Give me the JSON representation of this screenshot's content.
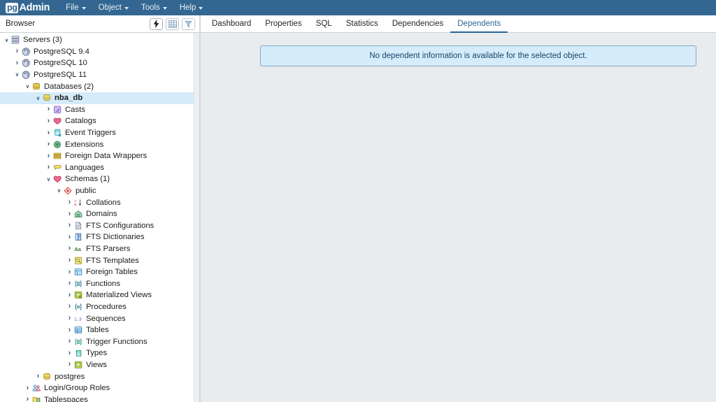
{
  "app": {
    "brand_pg": "pg",
    "brand_admin": "Admin",
    "accent_color": "#336791",
    "selection_color": "#d4ebfa",
    "link_color": "#2a6496"
  },
  "menubar": {
    "items": [
      {
        "label": "File",
        "icon": "chevron-down-icon"
      },
      {
        "label": "Object",
        "icon": "chevron-down-icon"
      },
      {
        "label": "Tools",
        "icon": "chevron-down-icon"
      },
      {
        "label": "Help",
        "icon": "chevron-down-icon"
      }
    ]
  },
  "browser": {
    "title": "Browser",
    "toolbar": [
      {
        "name": "quick-query-tool-button",
        "icon": "lightning-bolt-icon",
        "state": "enabled"
      },
      {
        "name": "view-data-button",
        "icon": "grid-table-icon",
        "state": "muted"
      },
      {
        "name": "filter-button",
        "icon": "funnel-filter-icon",
        "state": "muted"
      }
    ],
    "tree": [
      {
        "label": "Servers (3)",
        "depth": 0,
        "twisty": "expanded",
        "icon": "servers-icon"
      },
      {
        "label": "PostgreSQL 9.4",
        "depth": 1,
        "twisty": "collapsed",
        "icon": "postgres-elephant-icon"
      },
      {
        "label": "PostgreSQL 10",
        "depth": 1,
        "twisty": "collapsed",
        "icon": "postgres-elephant-icon"
      },
      {
        "label": "PostgreSQL 11",
        "depth": 1,
        "twisty": "expanded",
        "icon": "postgres-elephant-icon"
      },
      {
        "label": "Databases (2)",
        "depth": 2,
        "twisty": "expanded",
        "icon": "databases-icon"
      },
      {
        "label": "nba_db",
        "depth": 3,
        "twisty": "expanded",
        "icon": "database-icon",
        "selected": true
      },
      {
        "label": "Casts",
        "depth": 4,
        "twisty": "collapsed",
        "icon": "casts-icon"
      },
      {
        "label": "Catalogs",
        "depth": 4,
        "twisty": "collapsed",
        "icon": "catalogs-icon"
      },
      {
        "label": "Event Triggers",
        "depth": 4,
        "twisty": "collapsed",
        "icon": "event-triggers-icon"
      },
      {
        "label": "Extensions",
        "depth": 4,
        "twisty": "collapsed",
        "icon": "extensions-icon"
      },
      {
        "label": "Foreign Data Wrappers",
        "depth": 4,
        "twisty": "collapsed",
        "icon": "foreign-data-wrappers-icon"
      },
      {
        "label": "Languages",
        "depth": 4,
        "twisty": "collapsed",
        "icon": "languages-icon"
      },
      {
        "label": "Schemas (1)",
        "depth": 4,
        "twisty": "expanded",
        "icon": "schemas-icon"
      },
      {
        "label": "public",
        "depth": 5,
        "twisty": "expanded",
        "icon": "schema-public-icon"
      },
      {
        "label": "Collations",
        "depth": 6,
        "twisty": "collapsed",
        "icon": "collations-icon"
      },
      {
        "label": "Domains",
        "depth": 6,
        "twisty": "collapsed",
        "icon": "domains-icon"
      },
      {
        "label": "FTS Configurations",
        "depth": 6,
        "twisty": "collapsed",
        "icon": "fts-configurations-icon"
      },
      {
        "label": "FTS Dictionaries",
        "depth": 6,
        "twisty": "collapsed",
        "icon": "fts-dictionaries-icon"
      },
      {
        "label": "FTS Parsers",
        "depth": 6,
        "twisty": "collapsed",
        "icon": "fts-parsers-icon"
      },
      {
        "label": "FTS Templates",
        "depth": 6,
        "twisty": "collapsed",
        "icon": "fts-templates-icon"
      },
      {
        "label": "Foreign Tables",
        "depth": 6,
        "twisty": "collapsed",
        "icon": "foreign-tables-icon"
      },
      {
        "label": "Functions",
        "depth": 6,
        "twisty": "collapsed",
        "icon": "functions-icon"
      },
      {
        "label": "Materialized Views",
        "depth": 6,
        "twisty": "collapsed",
        "icon": "materialized-views-icon"
      },
      {
        "label": "Procedures",
        "depth": 6,
        "twisty": "collapsed",
        "icon": "procedures-icon"
      },
      {
        "label": "Sequences",
        "depth": 6,
        "twisty": "collapsed",
        "icon": "sequences-icon"
      },
      {
        "label": "Tables",
        "depth": 6,
        "twisty": "collapsed",
        "icon": "tables-icon"
      },
      {
        "label": "Trigger Functions",
        "depth": 6,
        "twisty": "collapsed",
        "icon": "trigger-functions-icon"
      },
      {
        "label": "Types",
        "depth": 6,
        "twisty": "collapsed",
        "icon": "types-icon"
      },
      {
        "label": "Views",
        "depth": 6,
        "twisty": "collapsed",
        "icon": "views-icon"
      },
      {
        "label": "postgres",
        "depth": 3,
        "twisty": "collapsed",
        "icon": "database-icon"
      },
      {
        "label": "Login/Group Roles",
        "depth": 2,
        "twisty": "collapsed",
        "icon": "login-group-roles-icon"
      },
      {
        "label": "Tablespaces",
        "depth": 2,
        "twisty": "collapsed",
        "icon": "tablespaces-icon"
      }
    ]
  },
  "main": {
    "tabs": [
      {
        "label": "Dashboard",
        "active": false
      },
      {
        "label": "Properties",
        "active": false
      },
      {
        "label": "SQL",
        "active": false
      },
      {
        "label": "Statistics",
        "active": false
      },
      {
        "label": "Dependencies",
        "active": false
      },
      {
        "label": "Dependents",
        "active": true
      }
    ],
    "alert": {
      "message": "No dependent information is available for the selected object."
    }
  }
}
